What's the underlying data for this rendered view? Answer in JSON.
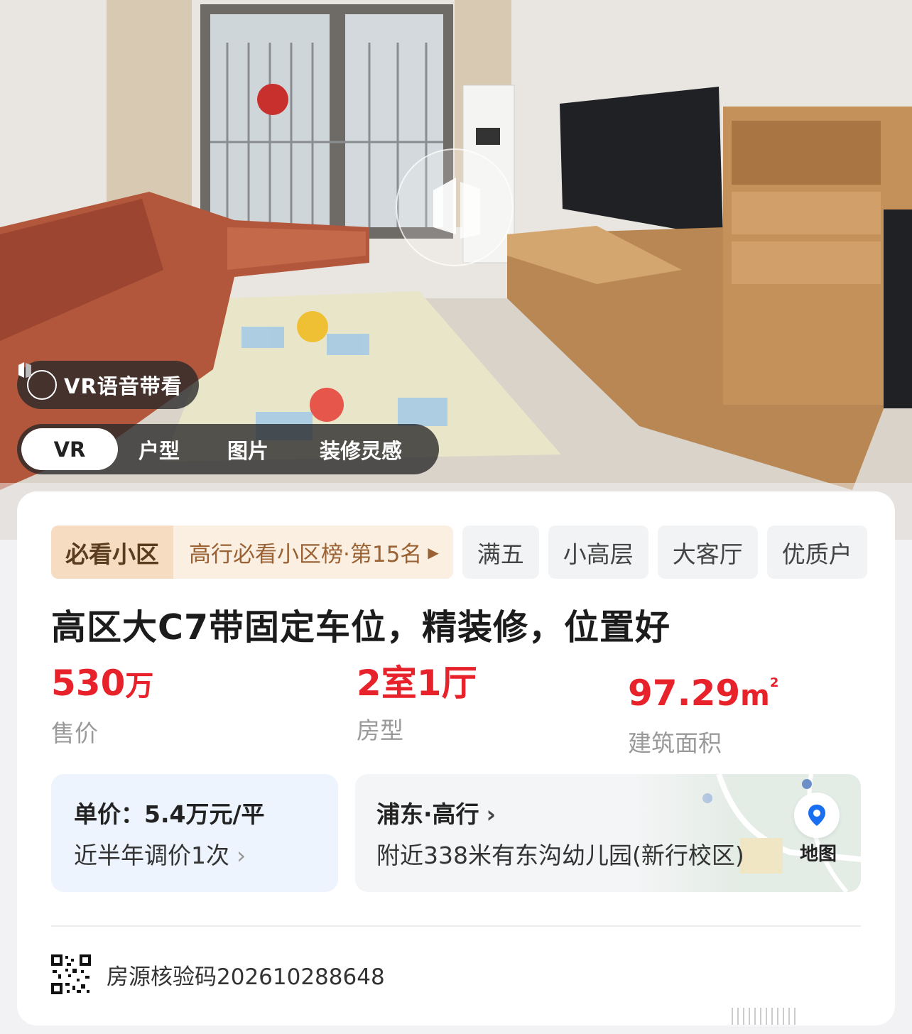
{
  "media": {
    "vr_badge": "VR语音带看",
    "tabs": [
      {
        "label": "VR",
        "active": true
      },
      {
        "label": "户型",
        "active": false
      },
      {
        "label": "图片",
        "active": false
      },
      {
        "label": "装修灵感",
        "active": false
      }
    ]
  },
  "tags": {
    "rank_label": "必看小区",
    "rank_text": "高行必看小区榜·第15名",
    "items": [
      "满五",
      "小高层",
      "大客厅",
      "优质户"
    ]
  },
  "listing": {
    "title": "高区大C7带固定车位，精装修，位置好",
    "price": {
      "value": "530",
      "unit": "万",
      "label": "售价"
    },
    "layout": {
      "value": "2室1厅",
      "label": "房型"
    },
    "area": {
      "value": "97.29",
      "unit": "m",
      "sup": "2",
      "label": "建筑面积"
    }
  },
  "unit_price": {
    "line1": "单价：5.4万元/平",
    "line2": "近半年调价1次"
  },
  "location": {
    "district": "浦东·高行",
    "nearby": "附近338米有东沟幼儿园(新行校区)",
    "map_label": "地图"
  },
  "verify": {
    "text": "房源核验码202610288648"
  },
  "colors": {
    "accent_red": "#e8222b",
    "rank_bg": "#f6dcc0",
    "map_pin": "#1a6ff0"
  }
}
